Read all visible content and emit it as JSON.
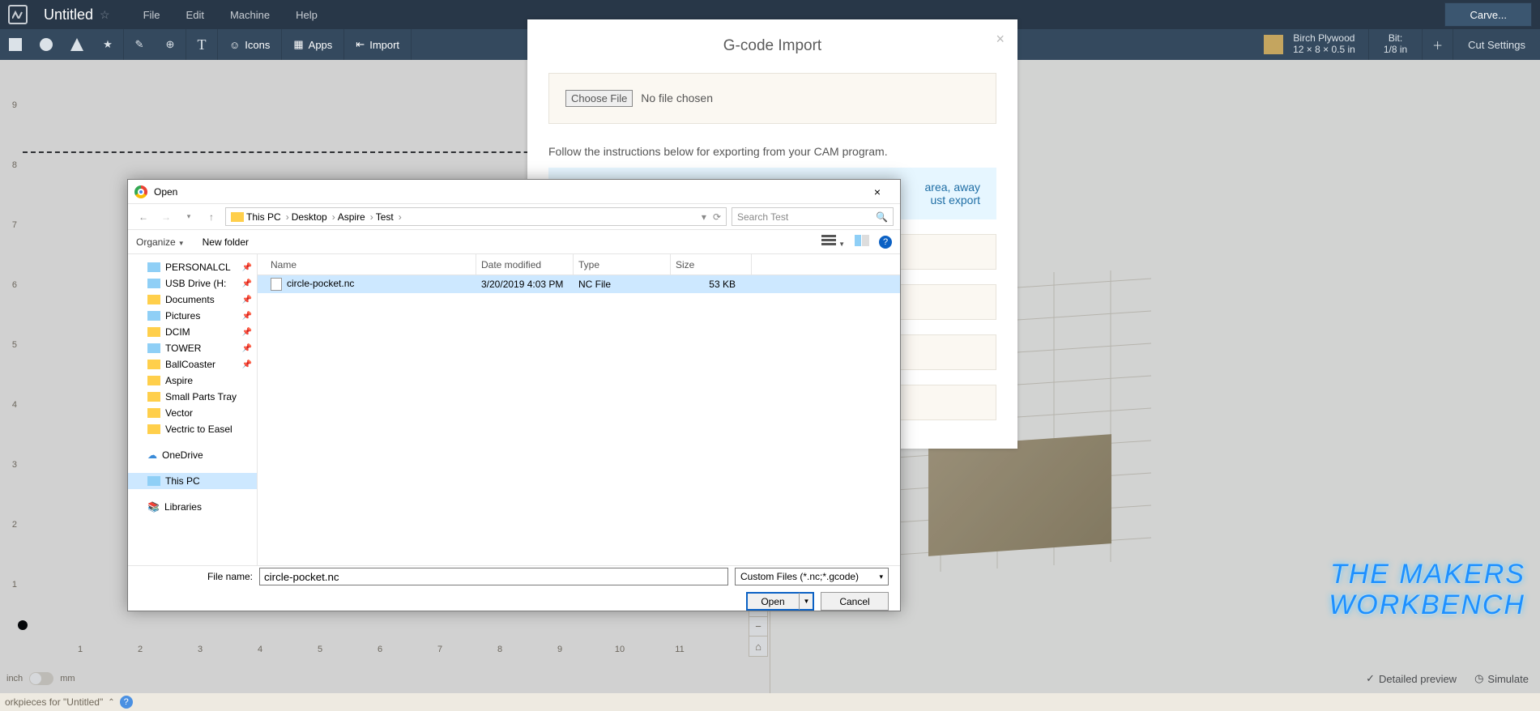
{
  "menubar": {
    "doc_title": "Untitled",
    "items": {
      "file": "File",
      "edit": "Edit",
      "machine": "Machine",
      "help": "Help"
    },
    "carve": "Carve..."
  },
  "toolbar": {
    "icons_label": "Icons",
    "apps_label": "Apps",
    "import_label": "Import",
    "material_name": "Birch Plywood",
    "material_dims": "12 × 8 × 0.5 in",
    "bit_label": "Bit:",
    "bit_size": "1/8 in",
    "cut_settings": "Cut Settings"
  },
  "canvas": {
    "vticks": [
      "9",
      "8",
      "7",
      "6",
      "5",
      "4",
      "3",
      "2",
      "1"
    ],
    "hticks": [
      "1",
      "2",
      "3",
      "4",
      "5",
      "6",
      "7",
      "8",
      "9",
      "10",
      "11"
    ],
    "unit_inch": "inch",
    "unit_mm": "mm"
  },
  "preview": {
    "detailed": "Detailed preview",
    "simulate": "Simulate"
  },
  "bottombar": {
    "label": "orkpieces for \"Untitled\""
  },
  "gcode_modal": {
    "title": "G-code Import",
    "choose_file": "Choose File",
    "no_file": "No file chosen",
    "instructions": "Follow the instructions below for exporting from your CAM program.",
    "note_frag1": "area, away",
    "note_frag2": "ust export"
  },
  "win": {
    "title": "Open",
    "crumbs": [
      "This PC",
      "Desktop",
      "Aspire",
      "Test"
    ],
    "search_placeholder": "Search Test",
    "organize": "Organize",
    "new_folder": "New folder",
    "cols": {
      "name": "Name",
      "date": "Date modified",
      "type": "Type",
      "size": "Size"
    },
    "tree": [
      {
        "label": "PERSONALCL",
        "icon": "dico",
        "pin": true
      },
      {
        "label": "USB Drive (H:",
        "icon": "dico",
        "pin": true
      },
      {
        "label": "Documents",
        "icon": "fico",
        "pin": true
      },
      {
        "label": "Pictures",
        "icon": "dico",
        "pin": true
      },
      {
        "label": "DCIM",
        "icon": "fico",
        "pin": true
      },
      {
        "label": "TOWER",
        "icon": "dico",
        "pin": true
      },
      {
        "label": "BallCoaster",
        "icon": "fico",
        "pin": true
      },
      {
        "label": "Aspire",
        "icon": "fico",
        "pin": false
      },
      {
        "label": "Small Parts Tray",
        "icon": "fico",
        "pin": false
      },
      {
        "label": "Vector",
        "icon": "fico",
        "pin": false
      },
      {
        "label": "Vectric to Easel",
        "icon": "fico",
        "pin": false
      },
      {
        "label": "OneDrive",
        "icon": "cloud",
        "pin": false,
        "space_before": true
      },
      {
        "label": "This PC",
        "icon": "dico",
        "pin": false,
        "selected": true,
        "space_before": true
      },
      {
        "label": "Libraries",
        "icon": "lib",
        "pin": false,
        "space_before": true
      }
    ],
    "rows": [
      {
        "name": "circle-pocket.nc",
        "date": "3/20/2019 4:03 PM",
        "type": "NC File",
        "size": "53 KB"
      }
    ],
    "filename_label": "File name:",
    "filename_value": "circle-pocket.nc",
    "filter": "Custom Files (*.nc;*.gcode)",
    "open_btn": "Open",
    "cancel_btn": "Cancel"
  },
  "watermark": {
    "line1": "THE MAKERS",
    "line2": "WORKBENCH"
  }
}
